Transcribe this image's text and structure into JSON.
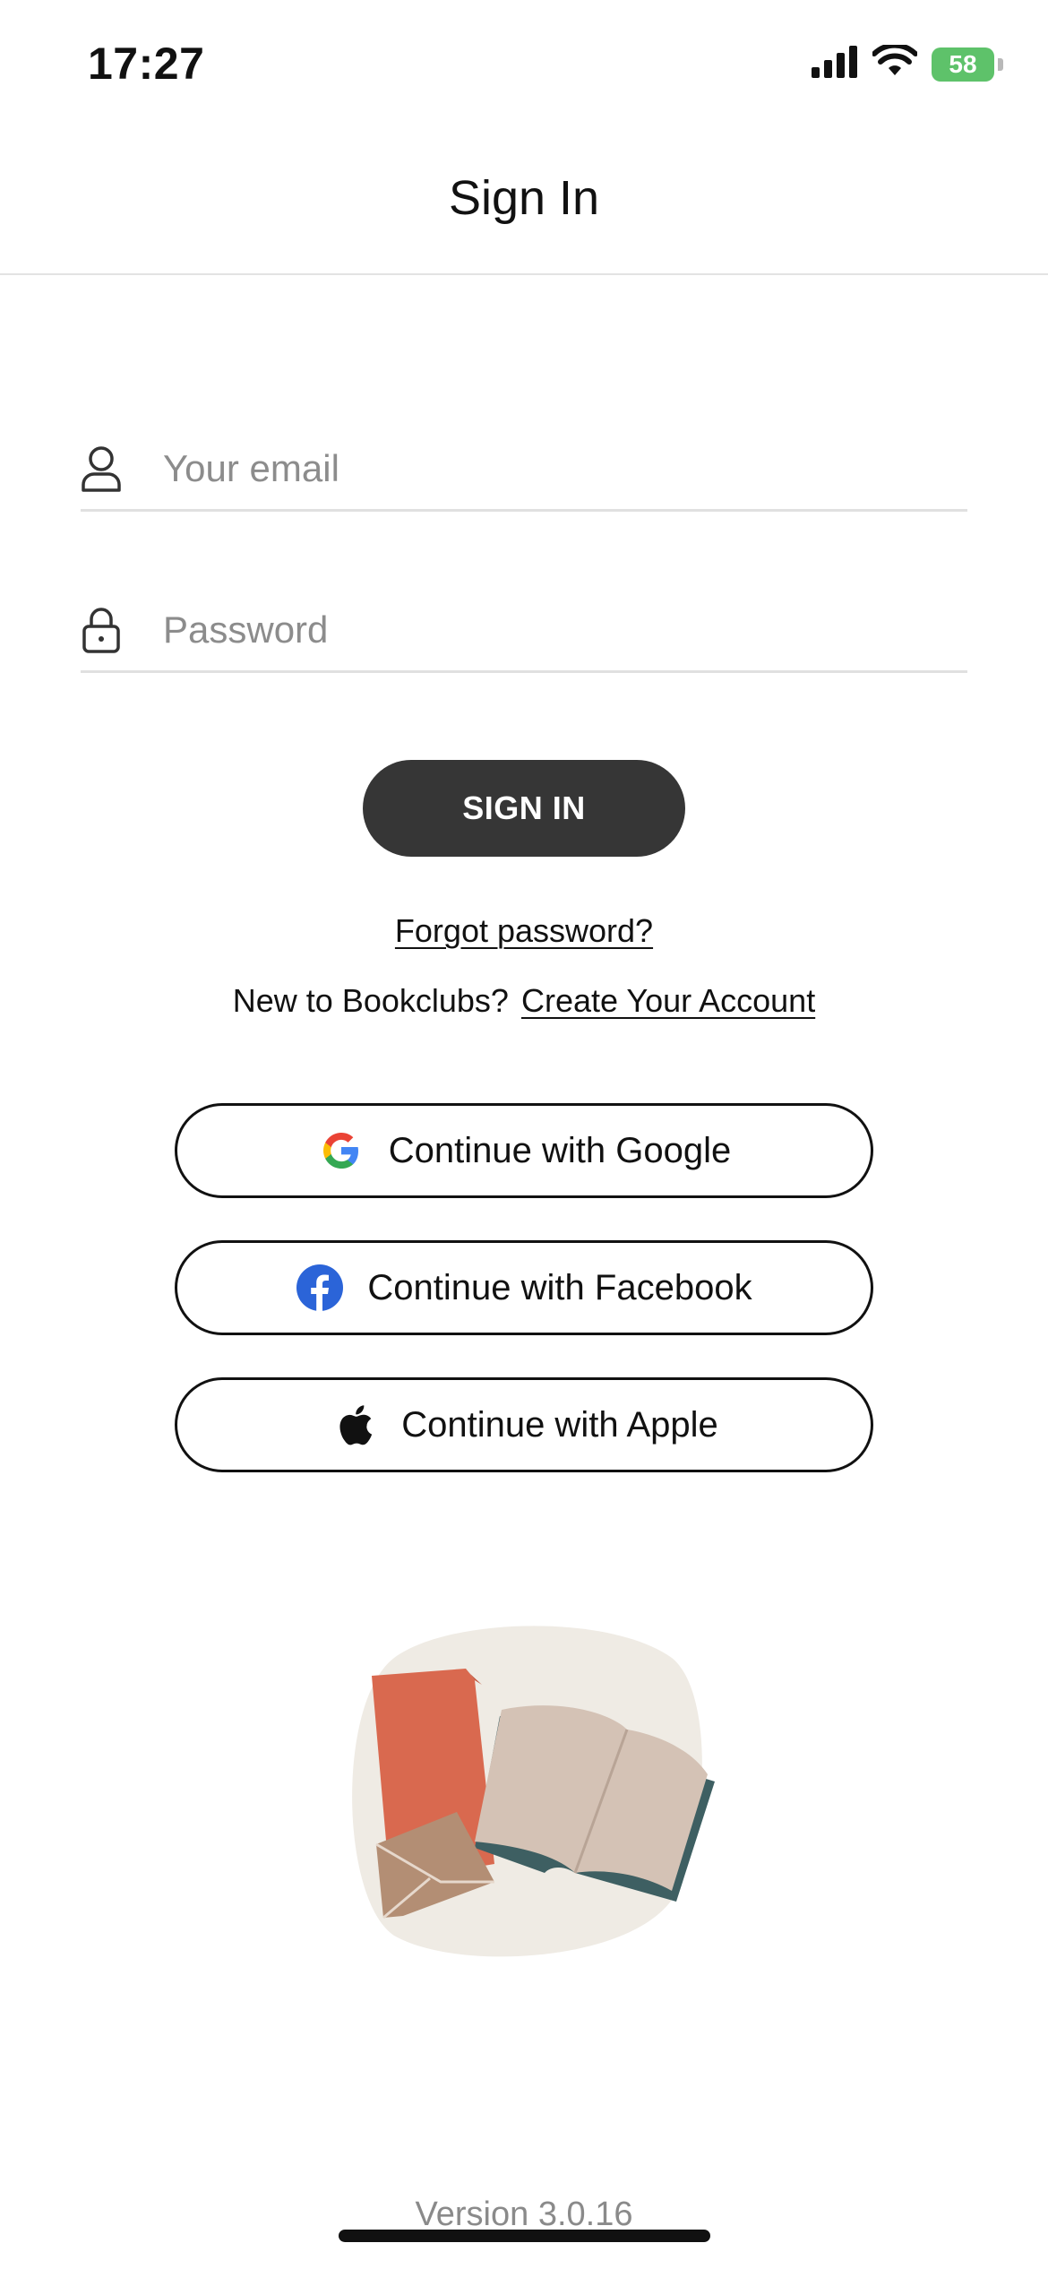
{
  "status_bar": {
    "time": "17:27",
    "battery": "58",
    "icons": [
      "signal-icon",
      "wifi-icon",
      "battery-icon"
    ]
  },
  "header": {
    "title": "Sign In"
  },
  "form": {
    "email": {
      "placeholder": "Your email",
      "value": "",
      "icon": "user-icon"
    },
    "password": {
      "placeholder": "Password",
      "value": "",
      "icon": "lock-icon"
    },
    "signin_label": "SIGN IN"
  },
  "links": {
    "forgot": "Forgot password?",
    "new_prompt": "New to Bookclubs?",
    "create_account": "Create Your Account"
  },
  "social": {
    "google": {
      "label": "Continue with Google",
      "icon": "google-icon"
    },
    "facebook": {
      "label": "Continue with Facebook",
      "icon": "facebook-icon"
    },
    "apple": {
      "label": "Continue with Apple",
      "icon": "apple-icon"
    }
  },
  "footer": {
    "version": "Version 3.0.16"
  },
  "colors": {
    "primary_button": "#363636",
    "facebook_blue": "#2b64d8",
    "battery_green": "#5ec26a",
    "book_red": "#d9694f",
    "book_teal": "#3e5f62",
    "envelope": "#b38e74",
    "blob_bg": "#efebe4"
  }
}
